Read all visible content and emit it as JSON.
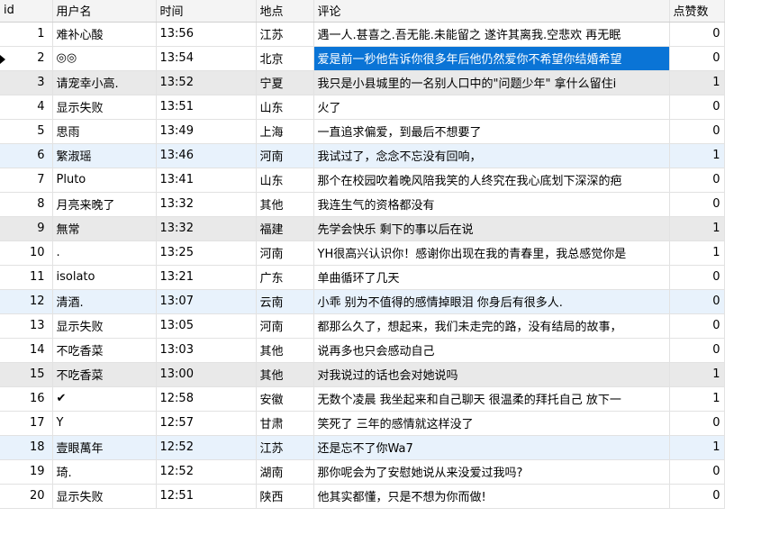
{
  "columns": [
    "id",
    "用户名",
    "时间",
    "地点",
    "评论",
    "点赞数"
  ],
  "rows": [
    {
      "id": "1",
      "user": "难补心酸",
      "time": "13:56",
      "place": "江苏",
      "comment": "遇一人.甚喜之.吾无能.未能留之 遂许其离我.空悲欢 再无眠",
      "likes": "0"
    },
    {
      "id": "2",
      "user": "◎◎",
      "time": "13:54",
      "place": "北京",
      "comment": "爱是前一秒他告诉你很多年后他仍然爱你不希望你结婚希望",
      "likes": "0"
    },
    {
      "id": "3",
      "user": "请宠幸小高.",
      "time": "13:52",
      "place": "宁夏",
      "comment": "我只是小县城里的一名别人口中的\"问题少年\" 拿什么留住i",
      "likes": "1"
    },
    {
      "id": "4",
      "user": "显示失败",
      "time": "13:51",
      "place": "山东",
      "comment": "火了",
      "likes": "0"
    },
    {
      "id": "5",
      "user": "思雨",
      "time": "13:49",
      "place": "上海",
      "comment": "一直追求偏爱，到最后不想要了",
      "likes": "0"
    },
    {
      "id": "6",
      "user": "繁淑瑶",
      "time": "13:46",
      "place": "河南",
      "comment": "我试过了，念念不忘没有回响，",
      "likes": "1"
    },
    {
      "id": "7",
      "user": "Pluto",
      "time": "13:41",
      "place": "山东",
      "comment": "那个在校园吹着晚风陪我笑的人终究在我心底划下深深的疤",
      "likes": "0"
    },
    {
      "id": "8",
      "user": "月亮来晚了",
      "time": "13:32",
      "place": "其他",
      "comment": "我连生气的资格都没有",
      "likes": "0"
    },
    {
      "id": "9",
      "user": "無常",
      "time": "13:32",
      "place": "福建",
      "comment": "先学会快乐 剩下的事以后在说",
      "likes": "1"
    },
    {
      "id": "10",
      "user": ".",
      "time": "13:25",
      "place": "河南",
      "comment": "YH很高兴认识你！感谢你出现在我的青春里，我总感觉你是",
      "likes": "1"
    },
    {
      "id": "11",
      "user": "isolato",
      "time": "13:21",
      "place": "广东",
      "comment": "单曲循环了几天",
      "likes": "0"
    },
    {
      "id": "12",
      "user": "清酒.",
      "time": "13:07",
      "place": "云南",
      "comment": "小乖  别为不值得的感情掉眼泪  你身后有很多人.",
      "likes": "0"
    },
    {
      "id": "13",
      "user": "显示失败",
      "time": "13:05",
      "place": "河南",
      "comment": "都那么久了，想起来，我们未走完的路，没有结局的故事，",
      "likes": "0"
    },
    {
      "id": "14",
      "user": "不吃香菜",
      "time": "13:03",
      "place": "其他",
      "comment": "说再多也只会感动自己",
      "likes": "0"
    },
    {
      "id": "15",
      "user": "不吃香菜",
      "time": "13:00",
      "place": "其他",
      "comment": "对我说过的话也会对她说吗",
      "likes": "1"
    },
    {
      "id": "16",
      "user": "✔",
      "time": "12:58",
      "place": "安徽",
      "comment": "无数个凌晨 我坐起来和自己聊天 很温柔的拜托自己 放下一",
      "likes": "1"
    },
    {
      "id": "17",
      "user": "Y",
      "time": "12:57",
      "place": "甘肃",
      "comment": "笑死了 三年的感情就这样没了",
      "likes": "0"
    },
    {
      "id": "18",
      "user": "壹眼萬年",
      "time": "12:52",
      "place": "江苏",
      "comment": "还是忘不了你Wa7",
      "likes": "1"
    },
    {
      "id": "19",
      "user": "琦.",
      "time": "12:52",
      "place": "湖南",
      "comment": "那你呢会为了安慰她说从来没爱过我吗?",
      "likes": "0"
    },
    {
      "id": "20",
      "user": "显示失败",
      "time": "12:51",
      "place": "陕西",
      "comment": "他其实都懂，只是不想为你而做!",
      "likes": "0"
    }
  ]
}
